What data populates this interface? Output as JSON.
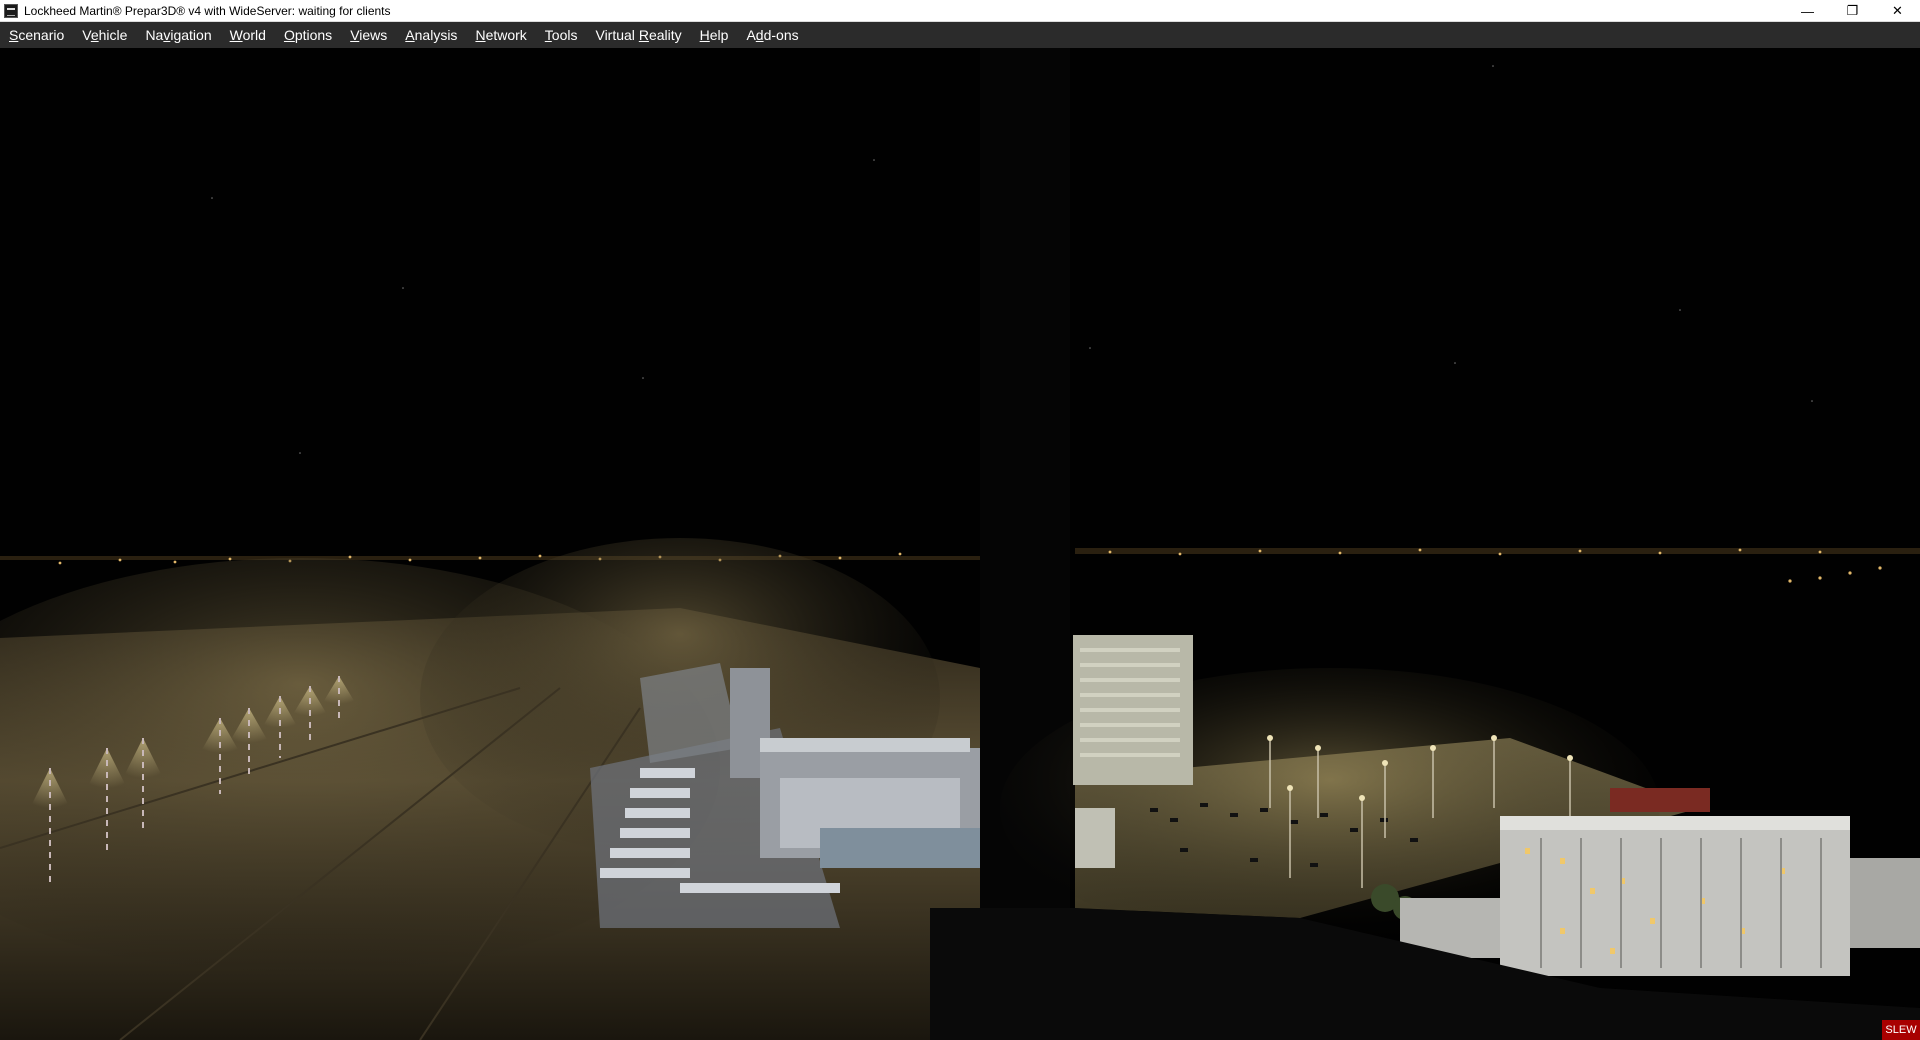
{
  "window": {
    "title": "Lockheed Martin® Prepar3D® v4 with WideServer: waiting for clients",
    "minimize_glyph": "—",
    "maximize_glyph": "❐",
    "close_glyph": "✕"
  },
  "menu": {
    "items": [
      {
        "pre": "",
        "ul": "S",
        "post": "cenario"
      },
      {
        "pre": "V",
        "ul": "e",
        "post": "hicle"
      },
      {
        "pre": "Na",
        "ul": "v",
        "post": "igation"
      },
      {
        "pre": "",
        "ul": "W",
        "post": "orld"
      },
      {
        "pre": "",
        "ul": "O",
        "post": "ptions"
      },
      {
        "pre": "",
        "ul": "V",
        "post": "iews"
      },
      {
        "pre": "",
        "ul": "A",
        "post": "nalysis"
      },
      {
        "pre": "",
        "ul": "N",
        "post": "etwork"
      },
      {
        "pre": "",
        "ul": "T",
        "post": "ools"
      },
      {
        "pre": "Virtual ",
        "ul": "R",
        "post": "eality"
      },
      {
        "pre": "",
        "ul": "H",
        "post": "elp"
      },
      {
        "pre": "A",
        "ul": "d",
        "post": "d-ons"
      }
    ]
  },
  "status": {
    "slew_label": "SLEW"
  },
  "colors": {
    "sky": "#010101",
    "apron_light": "#7a6a44",
    "slew_bg": "#a80000",
    "menubar_bg": "#2b2b2b"
  }
}
